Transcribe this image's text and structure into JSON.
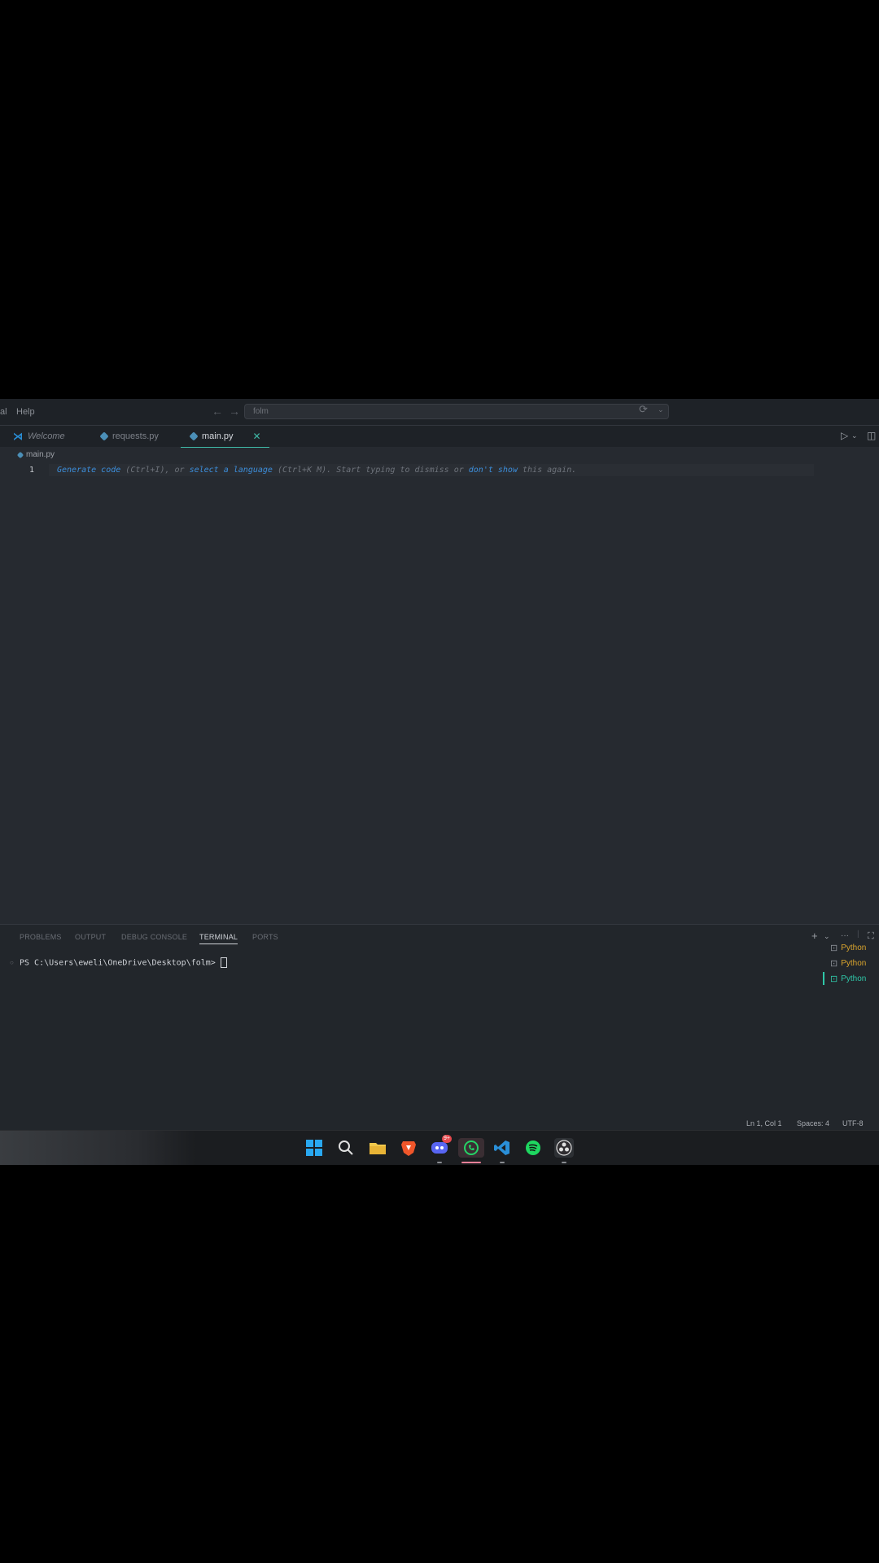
{
  "menu": {
    "left_fragment": "al",
    "help": "Help"
  },
  "command_center": {
    "text": "folm"
  },
  "tabs": [
    {
      "label": "Welcome",
      "icon": "vscode-icon"
    },
    {
      "label": "requests.py",
      "icon": "python-file-icon"
    },
    {
      "label": "main.py",
      "icon": "python-file-icon",
      "active": true
    }
  ],
  "editor": {
    "breadcrumb": "main.py",
    "line_number": "1",
    "hint": {
      "link1": "Generate code",
      "text1": " (Ctrl+I), or ",
      "link2": "select a language",
      "text2": " (Ctrl+K M). Start typing to dismiss or ",
      "link3": "don't show",
      "text3": " this again."
    }
  },
  "panel": {
    "tabs": [
      "PROBLEMS",
      "OUTPUT",
      "DEBUG CONSOLE",
      "TERMINAL",
      "PORTS"
    ],
    "active_tab": "TERMINAL",
    "prompt": "PS C:\\Users\\eweli\\OneDrive\\Desktop\\folm>",
    "terminals": [
      "Python",
      "Python",
      "Python"
    ]
  },
  "status": {
    "position": "Ln 1, Col 1",
    "spaces": "Spaces: 4",
    "encoding": "UTF-8"
  },
  "taskbar": {
    "icons": [
      "windows-start-icon",
      "search-icon",
      "file-explorer-icon",
      "brave-browser-icon",
      "discord-icon",
      "whatsapp-icon",
      "vscode-icon",
      "spotify-icon",
      "obs-icon"
    ],
    "discord_badge": "9+"
  },
  "colors": {
    "accent": "#3fb8a6",
    "link": "#3c8edb",
    "python": "#d9a42d"
  }
}
